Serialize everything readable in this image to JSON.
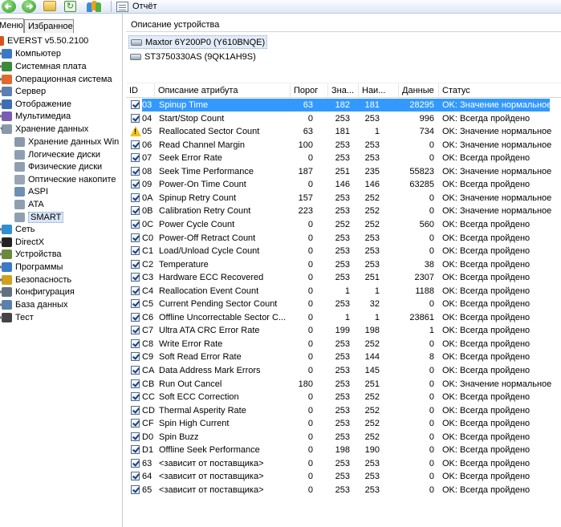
{
  "toolbar": {
    "report_label": "Отчёт"
  },
  "left_panel": {
    "tabs": [
      {
        "label": "Меню"
      },
      {
        "label": "Избранное"
      }
    ],
    "tree": [
      {
        "label": "EVERST v5.50.2100",
        "icon": "everest-icon",
        "color": "#d9531e"
      },
      {
        "label": "Компьютер",
        "icon": "computer-icon",
        "color": "#3b78c8"
      },
      {
        "label": "Системная плата",
        "icon": "motherboard-icon",
        "color": "#3a8a3a"
      },
      {
        "label": "Операционная система",
        "icon": "windows-icon",
        "color": "#e06a2b"
      },
      {
        "label": "Сервер",
        "icon": "server-icon",
        "color": "#5a7fb0"
      },
      {
        "label": "Отображение",
        "icon": "display-icon",
        "color": "#3c6fb5"
      },
      {
        "label": "Мультимедиа",
        "icon": "multimedia-icon",
        "color": "#7a5bb5"
      },
      {
        "label": "Хранение данных",
        "icon": "storage-icon",
        "color": "#8899aa"
      },
      {
        "label": "Хранение данных Win",
        "icon": "storage-win-icon",
        "color": "#8899aa"
      },
      {
        "label": "Логические диски",
        "icon": "logical-disk-icon",
        "color": "#8f9fb0"
      },
      {
        "label": "Физические диски",
        "icon": "physical-disk-icon",
        "color": "#8f9fb0"
      },
      {
        "label": "Оптические накопите",
        "icon": "optical-drive-icon",
        "color": "#9aa6b3"
      },
      {
        "label": "ASPI",
        "icon": "aspi-icon",
        "color": "#6f8fb5"
      },
      {
        "label": "ATA",
        "icon": "ata-icon",
        "color": "#8f9fb0"
      },
      {
        "label": "SMART",
        "icon": "smart-icon",
        "color": "#8f9fb0"
      },
      {
        "label": "Сеть",
        "icon": "network-icon",
        "color": "#2f8fd0"
      },
      {
        "label": "DirectX",
        "icon": "directx-icon",
        "color": "#222222"
      },
      {
        "label": "Устройства",
        "icon": "devices-icon",
        "color": "#6a8a3a"
      },
      {
        "label": "Программы",
        "icon": "programs-icon",
        "color": "#3a7ac8"
      },
      {
        "label": "Безопасность",
        "icon": "security-icon",
        "color": "#d0a020"
      },
      {
        "label": "Конфигурация",
        "icon": "configuration-icon",
        "color": "#607080"
      },
      {
        "label": "База данных",
        "icon": "database-icon",
        "color": "#5a80b0"
      },
      {
        "label": "Тест",
        "icon": "test-icon",
        "color": "#444444"
      }
    ]
  },
  "right_panel": {
    "device_header": "Описание устройства",
    "devices": [
      {
        "label": "Maxtor 6Y200P0 (Y610BNQE)"
      },
      {
        "label": "ST3750330AS (9QK1AH9S)"
      }
    ],
    "columns": [
      {
        "label": "ID"
      },
      {
        "label": "Описание атрибута"
      },
      {
        "label": "Порог"
      },
      {
        "label": "Зна..."
      },
      {
        "label": "Наи..."
      },
      {
        "label": "Данные"
      },
      {
        "label": "Статус"
      }
    ],
    "rows": [
      {
        "id": "03",
        "desc": "Spinup Time",
        "thr": "63",
        "val": "182",
        "worst": "181",
        "data": "28295",
        "status": "OK: Значение нормальное",
        "mark": "check"
      },
      {
        "id": "04",
        "desc": "Start/Stop Count",
        "thr": "0",
        "val": "253",
        "worst": "253",
        "data": "996",
        "status": "OK: Всегда пройдено",
        "mark": "check"
      },
      {
        "id": "05",
        "desc": "Reallocated Sector Count",
        "thr": "63",
        "val": "181",
        "worst": "1",
        "data": "734",
        "status": "OK: Значение нормальное",
        "mark": "warn"
      },
      {
        "id": "06",
        "desc": "Read Channel Margin",
        "thr": "100",
        "val": "253",
        "worst": "253",
        "data": "0",
        "status": "OK: Значение нормальное",
        "mark": "check"
      },
      {
        "id": "07",
        "desc": "Seek Error Rate",
        "thr": "0",
        "val": "253",
        "worst": "253",
        "data": "0",
        "status": "OK: Всегда пройдено",
        "mark": "check"
      },
      {
        "id": "08",
        "desc": "Seek Time Performance",
        "thr": "187",
        "val": "251",
        "worst": "235",
        "data": "55823",
        "status": "OK: Значение нормальное",
        "mark": "check"
      },
      {
        "id": "09",
        "desc": "Power-On Time Count",
        "thr": "0",
        "val": "146",
        "worst": "146",
        "data": "63285",
        "status": "OK: Всегда пройдено",
        "mark": "check"
      },
      {
        "id": "0A",
        "desc": "Spinup Retry Count",
        "thr": "157",
        "val": "253",
        "worst": "252",
        "data": "0",
        "status": "OK: Значение нормальное",
        "mark": "check"
      },
      {
        "id": "0B",
        "desc": "Calibration Retry Count",
        "thr": "223",
        "val": "253",
        "worst": "252",
        "data": "0",
        "status": "OK: Значение нормальное",
        "mark": "check"
      },
      {
        "id": "0C",
        "desc": "Power Cycle Count",
        "thr": "0",
        "val": "252",
        "worst": "252",
        "data": "560",
        "status": "OK: Всегда пройдено",
        "mark": "check"
      },
      {
        "id": "C0",
        "desc": "Power-Off Retract Count",
        "thr": "0",
        "val": "253",
        "worst": "253",
        "data": "0",
        "status": "OK: Всегда пройдено",
        "mark": "check"
      },
      {
        "id": "C1",
        "desc": "Load/Unload Cycle Count",
        "thr": "0",
        "val": "253",
        "worst": "253",
        "data": "0",
        "status": "OK: Всегда пройдено",
        "mark": "check"
      },
      {
        "id": "C2",
        "desc": "Temperature",
        "thr": "0",
        "val": "253",
        "worst": "253",
        "data": "38",
        "status": "OK: Всегда пройдено",
        "mark": "check"
      },
      {
        "id": "C3",
        "desc": "Hardware ECC Recovered",
        "thr": "0",
        "val": "253",
        "worst": "251",
        "data": "2307",
        "status": "OK: Всегда пройдено",
        "mark": "check"
      },
      {
        "id": "C4",
        "desc": "Reallocation Event Count",
        "thr": "0",
        "val": "1",
        "worst": "1",
        "data": "1188",
        "status": "OK: Всегда пройдено",
        "mark": "check"
      },
      {
        "id": "C5",
        "desc": "Current Pending Sector Count",
        "thr": "0",
        "val": "253",
        "worst": "32",
        "data": "0",
        "status": "OK: Всегда пройдено",
        "mark": "check"
      },
      {
        "id": "C6",
        "desc": "Offline Uncorrectable Sector C...",
        "thr": "0",
        "val": "1",
        "worst": "1",
        "data": "23861",
        "status": "OK: Всегда пройдено",
        "mark": "check"
      },
      {
        "id": "C7",
        "desc": "Ultra ATA CRC Error Rate",
        "thr": "0",
        "val": "199",
        "worst": "198",
        "data": "1",
        "status": "OK: Всегда пройдено",
        "mark": "check"
      },
      {
        "id": "C8",
        "desc": "Write Error Rate",
        "thr": "0",
        "val": "253",
        "worst": "252",
        "data": "0",
        "status": "OK: Всегда пройдено",
        "mark": "check"
      },
      {
        "id": "C9",
        "desc": "Soft Read Error Rate",
        "thr": "0",
        "val": "253",
        "worst": "144",
        "data": "8",
        "status": "OK: Всегда пройдено",
        "mark": "check"
      },
      {
        "id": "CA",
        "desc": "Data Address Mark Errors",
        "thr": "0",
        "val": "253",
        "worst": "145",
        "data": "0",
        "status": "OK: Всегда пройдено",
        "mark": "check"
      },
      {
        "id": "CB",
        "desc": "Run Out Cancel",
        "thr": "180",
        "val": "253",
        "worst": "251",
        "data": "0",
        "status": "OK: Значение нормальное",
        "mark": "check"
      },
      {
        "id": "CC",
        "desc": "Soft ECC Correction",
        "thr": "0",
        "val": "253",
        "worst": "252",
        "data": "0",
        "status": "OK: Всегда пройдено",
        "mark": "check"
      },
      {
        "id": "CD",
        "desc": "Thermal Asperity Rate",
        "thr": "0",
        "val": "253",
        "worst": "252",
        "data": "0",
        "status": "OK: Всегда пройдено",
        "mark": "check"
      },
      {
        "id": "CF",
        "desc": "Spin High Current",
        "thr": "0",
        "val": "253",
        "worst": "252",
        "data": "0",
        "status": "OK: Всегда пройдено",
        "mark": "check"
      },
      {
        "id": "D0",
        "desc": "Spin Buzz",
        "thr": "0",
        "val": "253",
        "worst": "252",
        "data": "0",
        "status": "OK: Всегда пройдено",
        "mark": "check"
      },
      {
        "id": "D1",
        "desc": "Offline Seek Performance",
        "thr": "0",
        "val": "198",
        "worst": "190",
        "data": "0",
        "status": "OK: Всегда пройдено",
        "mark": "check"
      },
      {
        "id": "63",
        "desc": "<зависит от поставщика>",
        "thr": "0",
        "val": "253",
        "worst": "253",
        "data": "0",
        "status": "OK: Всегда пройдено",
        "mark": "check"
      },
      {
        "id": "64",
        "desc": "<зависит от поставщика>",
        "thr": "0",
        "val": "253",
        "worst": "253",
        "data": "0",
        "status": "OK: Всегда пройдено",
        "mark": "check"
      },
      {
        "id": "65",
        "desc": "<зависит от поставщика>",
        "thr": "0",
        "val": "253",
        "worst": "253",
        "data": "0",
        "status": "OK: Всегда пройдено",
        "mark": "check"
      }
    ]
  },
  "colors": {
    "selection": "#3399ff",
    "warning": "#f2c21a"
  }
}
